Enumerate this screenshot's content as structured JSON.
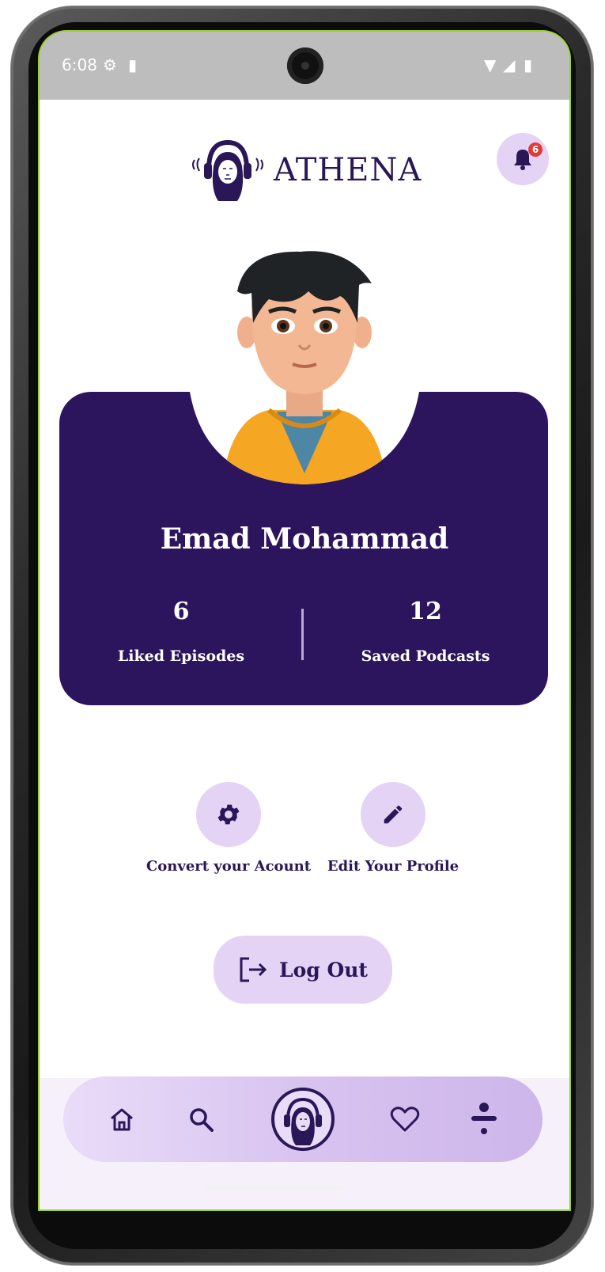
{
  "status_bar": {
    "time": "6:08",
    "icons": [
      "settings-sync-icon",
      "sd-card-icon",
      "wifi-icon",
      "signal-icon",
      "battery-icon"
    ]
  },
  "header": {
    "app_name": "ATHENA",
    "logo": "athena-headphones-logo",
    "notification_count": "6"
  },
  "profile": {
    "name": "Emad Mohammad",
    "stats": [
      {
        "value": "6",
        "label": "Liked Episodes"
      },
      {
        "value": "12",
        "label": "Saved Podcasts"
      }
    ]
  },
  "actions": [
    {
      "icon": "gear-icon",
      "label": "Convert your Acount"
    },
    {
      "icon": "pencil-icon",
      "label": "Edit Your Profile"
    }
  ],
  "logout": {
    "label": "Log Out",
    "icon": "logout-icon"
  },
  "bottom_nav": [
    "home-icon",
    "search-icon",
    "athena-logo",
    "heart-icon",
    "profile-icon"
  ],
  "colors": {
    "primary": "#2d155e",
    "accent_light": "#e4d3f5",
    "text_dark": "#2a1758",
    "badge": "#e53935"
  }
}
